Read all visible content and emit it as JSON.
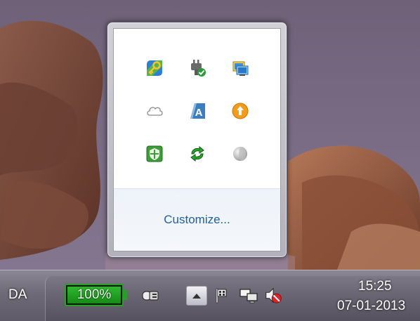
{
  "popup": {
    "customize_label": "Customize...",
    "icons": [
      {
        "name": "key-shield-icon"
      },
      {
        "name": "usb-plug-checkmark-icon"
      },
      {
        "name": "monitor-network-icon"
      },
      {
        "name": "cloud-icon"
      },
      {
        "name": "letter-a-app-icon"
      },
      {
        "name": "orange-update-arrow-icon"
      },
      {
        "name": "green-shield-icon"
      },
      {
        "name": "green-sync-arrows-icon"
      },
      {
        "name": "grey-sphere-icon"
      }
    ]
  },
  "taskbar": {
    "language": "DA",
    "battery_percent": "100%",
    "battery_level": 1.0,
    "time": "15:25",
    "date": "07-01-2013",
    "icons": [
      {
        "name": "power-plug-icon"
      },
      {
        "name": "show-hidden-icons-arrow"
      },
      {
        "name": "action-center-flag-icon"
      },
      {
        "name": "network-icon"
      },
      {
        "name": "speaker-muted-icon"
      }
    ]
  },
  "colors": {
    "battery_green": "#2a9d2a",
    "link_blue": "#1e5fa0",
    "mute_red": "#d8262b"
  }
}
